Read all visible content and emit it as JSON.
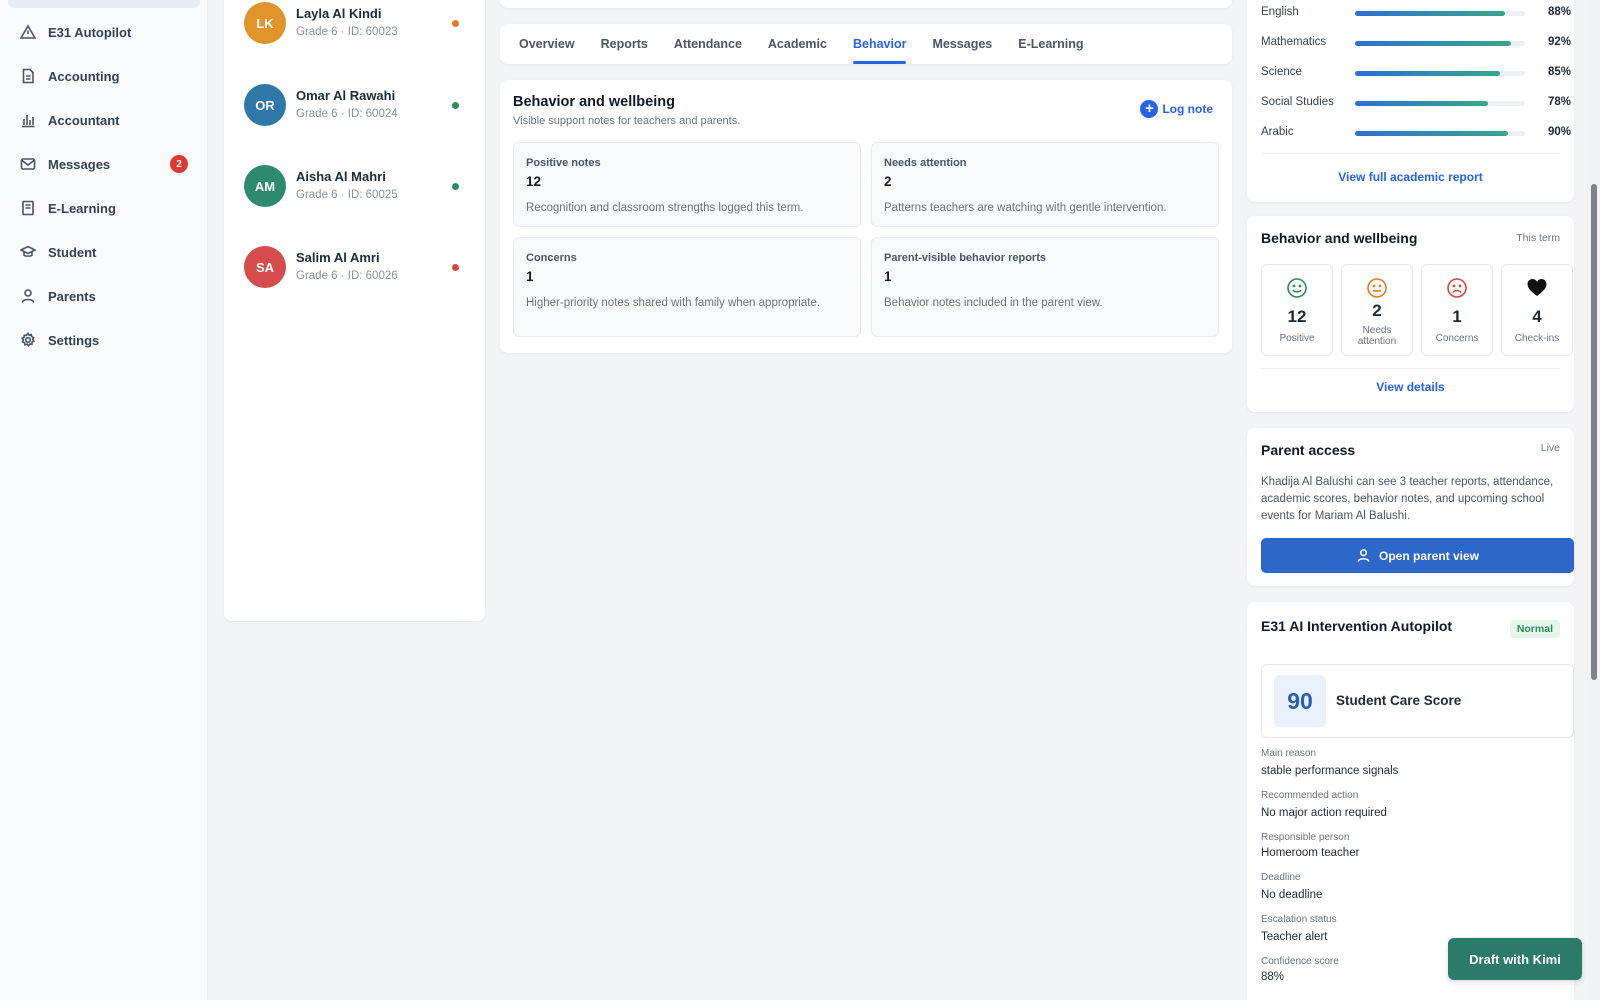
{
  "sidebar": {
    "items": [
      {
        "label": "E31 Autopilot",
        "icon": "alert-triangle-icon"
      },
      {
        "label": "Accounting",
        "icon": "document-icon"
      },
      {
        "label": "Accountant",
        "icon": "bar-chart-icon"
      },
      {
        "label": "Messages",
        "icon": "mail-icon",
        "badge": "2"
      },
      {
        "label": "E-Learning",
        "icon": "book-icon"
      },
      {
        "label": "Student",
        "icon": "graduation-cap-icon"
      },
      {
        "label": "Parents",
        "icon": "user-icon"
      },
      {
        "label": "Settings",
        "icon": "gear-icon"
      }
    ]
  },
  "students": [
    {
      "initials": "LK",
      "name": "Layla Al Kindi",
      "meta": "Grade 6 · ID: 60023",
      "avatar_color": "#e0952b",
      "status_color": "#e07b22"
    },
    {
      "initials": "OR",
      "name": "Omar Al Rawahi",
      "meta": "Grade 6 · ID: 60024",
      "avatar_color": "#2f79a8",
      "status_color": "#2e8b57"
    },
    {
      "initials": "AM",
      "name": "Aisha Al Mahri",
      "meta": "Grade 6 · ID: 60025",
      "avatar_color": "#2e8a6d",
      "status_color": "#2e8b57"
    },
    {
      "initials": "SA",
      "name": "Salim Al Amri",
      "meta": "Grade 6 · ID: 60026",
      "avatar_color": "#d64b4b",
      "status_color": "#d9463e"
    }
  ],
  "tabs": [
    "Overview",
    "Reports",
    "Attendance",
    "Academic",
    "Behavior",
    "Messages",
    "E-Learning"
  ],
  "active_tab": "Behavior",
  "behavior": {
    "title": "Behavior and wellbeing",
    "subtitle": "Visible support notes for teachers and parents.",
    "log_note": "Log note",
    "stats": [
      {
        "label": "Positive notes",
        "value": "12",
        "desc": "Recognition and classroom strengths logged this term."
      },
      {
        "label": "Needs attention",
        "value": "2",
        "desc": "Patterns teachers are watching with gentle intervention."
      },
      {
        "label": "Concerns",
        "value": "1",
        "desc": "Higher-priority notes shared with family when appropriate."
      },
      {
        "label": "Parent-visible behavior reports",
        "value": "1",
        "desc": "Behavior notes included in the parent view."
      }
    ]
  },
  "academic": {
    "subjects": [
      {
        "name": "English",
        "percent": 88,
        "label": "88%"
      },
      {
        "name": "Mathematics",
        "percent": 92,
        "label": "92%"
      },
      {
        "name": "Science",
        "percent": 85,
        "label": "85%"
      },
      {
        "name": "Social Studies",
        "percent": 78,
        "label": "78%"
      },
      {
        "name": "Arabic",
        "percent": 90,
        "label": "90%"
      }
    ],
    "link": "View full academic report"
  },
  "wellbeing": {
    "title": "Behavior and wellbeing",
    "tag": "This term",
    "boxes": [
      {
        "icon": "smile-icon",
        "value": "12",
        "label": "Positive",
        "color": "#2e8b57"
      },
      {
        "icon": "neutral-face-icon",
        "value": "2",
        "label": "Needs attention",
        "color": "#e07b22"
      },
      {
        "icon": "frown-icon",
        "value": "1",
        "label": "Concerns",
        "color": "#d9463e"
      },
      {
        "icon": "heart-icon",
        "value": "4",
        "label": "Check-ins",
        "color": "#111111"
      }
    ],
    "link": "View details"
  },
  "parent_access": {
    "title": "Parent access",
    "tag": "Live",
    "text": "Khadija Al Balushi can see 3 teacher reports, attendance, academic scores, behavior notes, and upcoming school events for Mariam Al Balushi.",
    "button": "Open parent view"
  },
  "autopilot": {
    "title": "E31 AI Intervention Autopilot",
    "badge": "Normal",
    "score": "90",
    "score_label": "Student Care Score",
    "fields": [
      {
        "label": "Main reason",
        "value": "stable performance signals"
      },
      {
        "label": "Recommended action",
        "value": "No major action required"
      },
      {
        "label": "Responsible person",
        "value": "Homeroom teacher"
      },
      {
        "label": "Deadline",
        "value": "No deadline"
      },
      {
        "label": "Escalation status",
        "value": "Teacher alert"
      },
      {
        "label": "Confidence score",
        "value": "88%"
      }
    ]
  },
  "floating_button": "Draft with Kimi"
}
